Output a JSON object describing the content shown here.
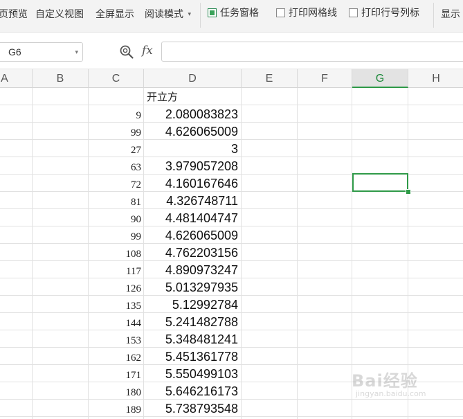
{
  "ribbon": {
    "items": [
      {
        "label": "页预览"
      },
      {
        "label": "自定义视图"
      },
      {
        "label": "全屏显示"
      },
      {
        "label": "阅读模式"
      }
    ],
    "checks": [
      {
        "label": "任务窗格",
        "checked": true
      },
      {
        "label": "打印网格线",
        "checked": false
      },
      {
        "label": "打印行号列标",
        "checked": false
      }
    ],
    "display_label": "显示"
  },
  "formula_bar": {
    "cell_ref": "G6",
    "fx_label": "fx",
    "formula": ""
  },
  "columns": [
    "A",
    "B",
    "C",
    "D",
    "E",
    "F",
    "G",
    "H"
  ],
  "selected_column": "G",
  "sheet": {
    "header_d": "开立方",
    "rows": [
      {
        "c": "9",
        "d": "2.080083823"
      },
      {
        "c": "99",
        "d": "4.626065009"
      },
      {
        "c": "27",
        "d": "3"
      },
      {
        "c": "63",
        "d": "3.979057208"
      },
      {
        "c": "72",
        "d": "4.160167646"
      },
      {
        "c": "81",
        "d": "4.326748711"
      },
      {
        "c": "90",
        "d": "4.481404747"
      },
      {
        "c": "99",
        "d": "4.626065009"
      },
      {
        "c": "108",
        "d": "4.762203156"
      },
      {
        "c": "117",
        "d": "4.890973247"
      },
      {
        "c": "126",
        "d": "5.013297935"
      },
      {
        "c": "135",
        "d": "5.12992784"
      },
      {
        "c": "144",
        "d": "5.241482788"
      },
      {
        "c": "153",
        "d": "5.348481241"
      },
      {
        "c": "162",
        "d": "5.451361778"
      },
      {
        "c": "171",
        "d": "5.550499103"
      },
      {
        "c": "180",
        "d": "5.646216173"
      },
      {
        "c": "189",
        "d": "5.738793548"
      }
    ]
  },
  "watermark": {
    "brand": "Bai经验",
    "url": "jingyan.baidu.com"
  },
  "colors": {
    "accent": "#2f9a48",
    "ribbon_bg": "#f3f3f3"
  }
}
